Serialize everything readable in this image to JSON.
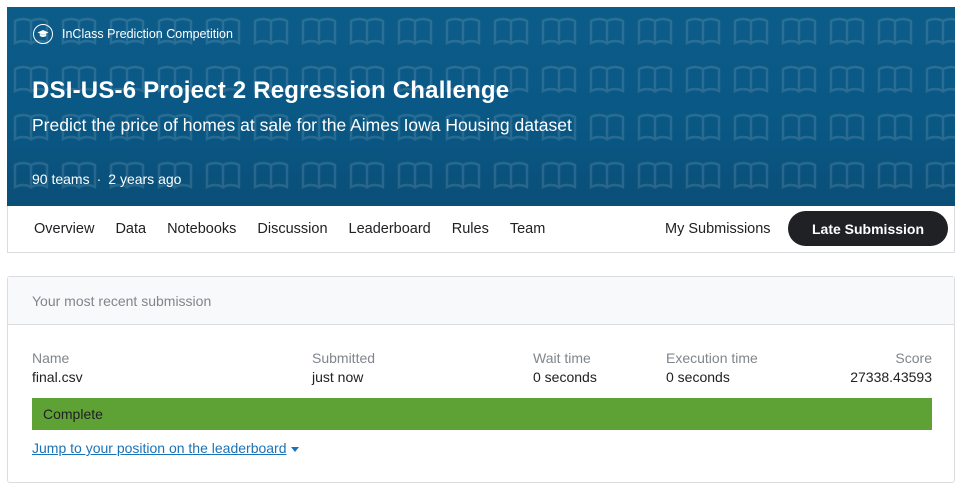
{
  "banner": {
    "competition_type": "InClass Prediction Competition",
    "title": "DSI-US-6 Project 2 Regression Challenge",
    "subtitle": "Predict the price of homes at sale for the Aimes Iowa Housing dataset",
    "teams": "90 teams",
    "separator": "·",
    "age": "2 years ago",
    "background_color": "#0c5c89"
  },
  "nav": {
    "tabs": [
      "Overview",
      "Data",
      "Notebooks",
      "Discussion",
      "Leaderboard",
      "Rules",
      "Team"
    ],
    "my_submissions": "My Submissions",
    "late_submission": "Late Submission"
  },
  "submission": {
    "header": "Your most recent submission",
    "columns": {
      "name_label": "Name",
      "name_value": "final.csv",
      "submitted_label": "Submitted",
      "submitted_value": "just now",
      "wait_label": "Wait time",
      "wait_value": "0 seconds",
      "exec_label": "Execution time",
      "exec_value": "0 seconds",
      "score_label": "Score",
      "score_value": "27338.43593"
    },
    "status": "Complete",
    "status_color": "#5ea134",
    "jump_link": "Jump to your position on the leaderboard"
  },
  "icons": {
    "competition": "graduation-cap-icon",
    "dropdown": "caret-down-icon"
  }
}
